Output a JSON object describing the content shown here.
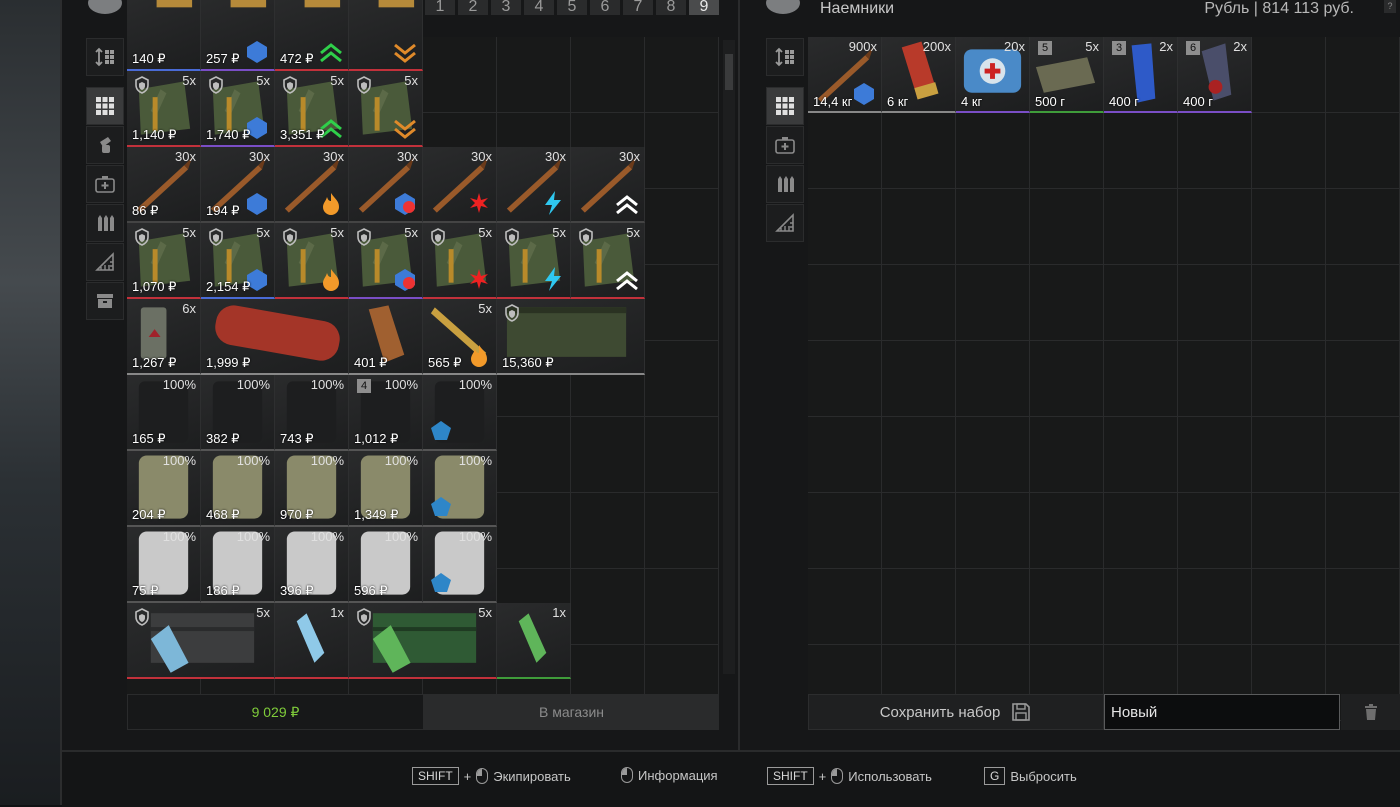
{
  "colors": {
    "accent_green": "#7fcc3a",
    "rarity_blue": "#4a6bd6",
    "rarity_red": "#c2313b",
    "rarity_purple": "#7a4ec6",
    "rarity_green": "#3f9c3a"
  },
  "left_panel": {
    "tabs": [
      "1",
      "2",
      "3",
      "4",
      "5",
      "6",
      "7",
      "8",
      "9"
    ],
    "active_tab": "9",
    "toolbar": [
      "sort-icon",
      "grid-icon",
      "grenade-icon",
      "medkit-icon",
      "ammo-icon",
      "ruler-icon",
      "archive-icon"
    ],
    "items": [
      {
        "price": "140 ₽",
        "qty": ""
      },
      {
        "price": "257 ₽",
        "qty": ""
      },
      {
        "price": "472 ₽",
        "qty": ""
      },
      {
        "price": "",
        "qty": ""
      },
      {
        "price": "1,140 ₽",
        "qty": "5x"
      },
      {
        "price": "1,740 ₽",
        "qty": "5x"
      },
      {
        "price": "3,351 ₽",
        "qty": "5x"
      },
      {
        "price": "",
        "qty": "5x"
      },
      {
        "price": "86 ₽",
        "qty": "30x"
      },
      {
        "price": "194 ₽",
        "qty": "30x"
      },
      {
        "price": "",
        "qty": "30x"
      },
      {
        "price": "",
        "qty": "30x"
      },
      {
        "price": "",
        "qty": "30x"
      },
      {
        "price": "",
        "qty": "30x"
      },
      {
        "price": "",
        "qty": "30x"
      },
      {
        "price": "1,070 ₽",
        "qty": "5x"
      },
      {
        "price": "2,154 ₽",
        "qty": "5x"
      },
      {
        "price": "",
        "qty": "5x"
      },
      {
        "price": "",
        "qty": "5x"
      },
      {
        "price": "",
        "qty": "5x"
      },
      {
        "price": "",
        "qty": "5x"
      },
      {
        "price": "",
        "qty": "5x"
      },
      {
        "price": "1,267 ₽",
        "qty": "6x"
      },
      {
        "price": "1,999 ₽",
        "qty": ""
      },
      {
        "price": "401 ₽",
        "qty": ""
      },
      {
        "price": "565 ₽",
        "qty": "5x"
      },
      {
        "price": "15,360 ₽",
        "qty": ""
      },
      {
        "price": "165 ₽",
        "qty": "100%"
      },
      {
        "price": "382 ₽",
        "qty": "100%"
      },
      {
        "price": "743 ₽",
        "qty": "100%"
      },
      {
        "price": "1,012 ₽",
        "qty": "100%",
        "badge": "4"
      },
      {
        "price": "",
        "qty": "100%"
      },
      {
        "price": "204 ₽",
        "qty": "100%"
      },
      {
        "price": "468 ₽",
        "qty": "100%"
      },
      {
        "price": "970 ₽",
        "qty": "100%"
      },
      {
        "price": "1,349 ₽",
        "qty": "100%"
      },
      {
        "price": "",
        "qty": "100%"
      },
      {
        "price": "75 ₽",
        "qty": "100%"
      },
      {
        "price": "186 ₽",
        "qty": "100%"
      },
      {
        "price": "396 ₽",
        "qty": "100%"
      },
      {
        "price": "596 ₽",
        "qty": "100%"
      },
      {
        "price": "",
        "qty": "100%"
      },
      {
        "price": "",
        "qty": "5x"
      },
      {
        "price": "",
        "qty": "1x"
      },
      {
        "price": "",
        "qty": "5x"
      },
      {
        "price": "",
        "qty": "1x"
      }
    ],
    "total": "9 029 ₽",
    "store_button": "В магазин"
  },
  "right_panel": {
    "title": "Наемники",
    "currency": "Рубль | 814 113 руб.",
    "help": "?",
    "toolbar": [
      "sort-icon",
      "grid-icon",
      "medkit-icon",
      "ammo-icon",
      "ruler-icon"
    ],
    "items": [
      {
        "qty": "900x",
        "weight": "14,4 кг"
      },
      {
        "qty": "200x",
        "weight": "6 кг"
      },
      {
        "qty": "20x",
        "weight": "4 кг"
      },
      {
        "qty": "5x",
        "weight": "500 г",
        "badge": "5"
      },
      {
        "qty": "2x",
        "weight": "400 г",
        "badge": "3"
      },
      {
        "qty": "2x",
        "weight": "400 г",
        "badge": "6"
      }
    ],
    "save_button": "Сохранить набор",
    "kit_name": "Новый"
  },
  "footer": {
    "hints": [
      {
        "key": "SHIFT",
        "plus": "+",
        "label": "Экипировать"
      },
      {
        "key": "",
        "plus": "",
        "label": "Информация"
      },
      {
        "key": "SHIFT",
        "plus": "+",
        "label": "Использовать"
      },
      {
        "key": "G",
        "plus": "",
        "label": "Выбросить"
      }
    ]
  }
}
